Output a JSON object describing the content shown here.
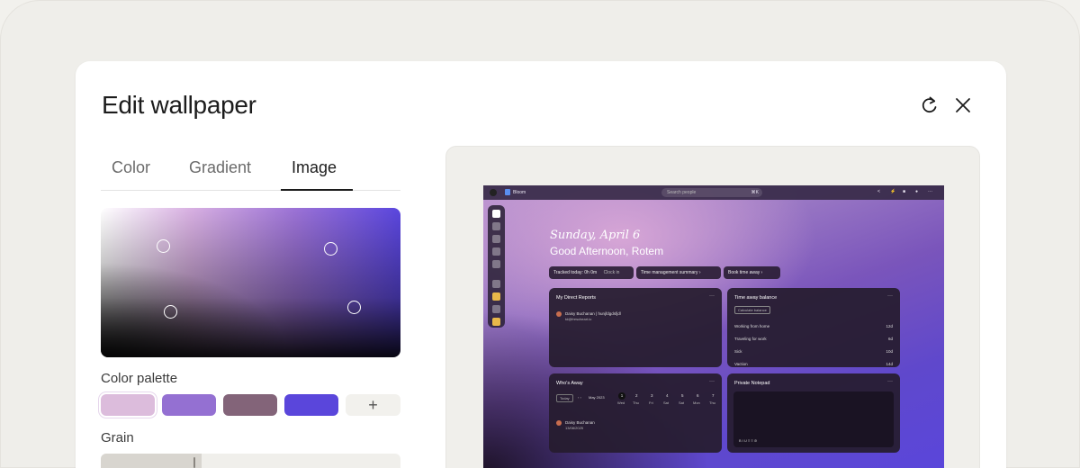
{
  "modal": {
    "title": "Edit wallpaper",
    "tabs": [
      {
        "label": "Color"
      },
      {
        "label": "Gradient"
      },
      {
        "label": "Image",
        "active": true
      }
    ],
    "color_palette_label": "Color palette",
    "palette": [
      "#dcbcdc",
      "#9470d2",
      "#836479",
      "#5a46db"
    ],
    "add_label": "+",
    "grain_label": "Grain"
  },
  "preview": {
    "topbar": {
      "brand": "Bloom",
      "search_placeholder": "Search people",
      "shortcut": "⌘K"
    },
    "date": "Sunday, April 6",
    "greeting": "Good Afternoon, Rotem",
    "pills": {
      "tracked": "Tracked today: 0h 0m",
      "clock_in": "Clock in",
      "time_summary": "Time management summary",
      "book_time": "Book time away"
    },
    "direct_reports": {
      "title": "My Direct Reports",
      "name": "Daisy Buchanan | hunjfdgdsfjdl",
      "email": "td@frescheart.io"
    },
    "time_away": {
      "title": "Time away balance",
      "button": "Calculate balance",
      "rows": [
        {
          "label": "Working from home",
          "value": "12d"
        },
        {
          "label": "Traveling for work",
          "value": "6d"
        },
        {
          "label": "Sick",
          "value": "10d"
        },
        {
          "label": "Vaction",
          "value": "14d"
        }
      ]
    },
    "whos_away": {
      "title": "Who's Away",
      "today": "Today",
      "month": "May 2023",
      "days": [
        {
          "num": "1",
          "dow": "Wed"
        },
        {
          "num": "2",
          "dow": "Thu"
        },
        {
          "num": "3",
          "dow": "Fri"
        },
        {
          "num": "4",
          "dow": "Sat"
        },
        {
          "num": "5",
          "dow": "Sat"
        },
        {
          "num": "6",
          "dow": "Mon"
        },
        {
          "num": "7",
          "dow": "Thu"
        }
      ],
      "person": "Daisy Buchanan",
      "date": "13/08/2025"
    },
    "notepad": {
      "title": "Private Notepad",
      "toolbar": "B  I  U  ≡  ≡  ⊘"
    }
  }
}
